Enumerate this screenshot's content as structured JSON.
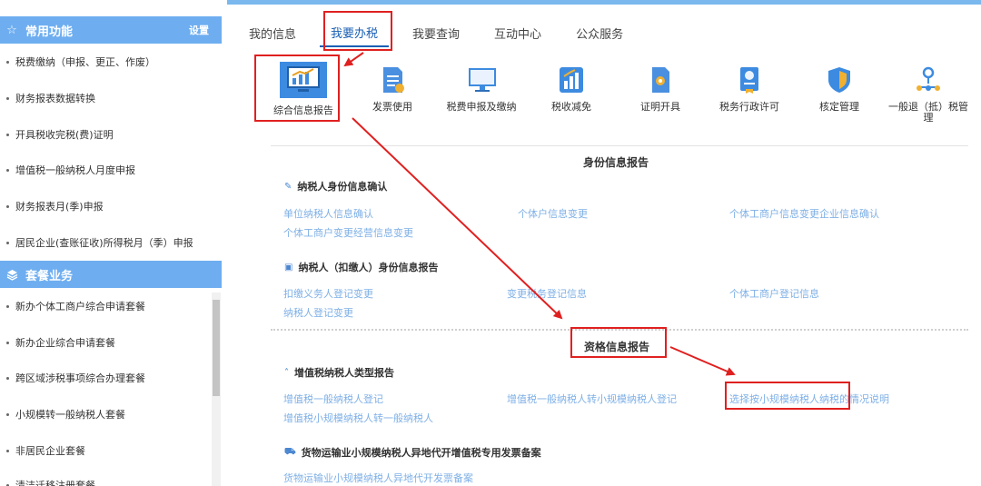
{
  "sidebar": {
    "common": {
      "title": "常用功能",
      "settings_label": "设置",
      "items": [
        "税费缴纳（申报、更正、作废）",
        "财务报表数据转换",
        "开具税收完税(费)证明",
        "增值税一般纳税人月度申报",
        "财务报表月(季)申报",
        "居民企业(查账征收)所得税月（季）申报"
      ]
    },
    "package": {
      "title": "套餐业务",
      "items": [
        "新办个体工商户综合申请套餐",
        "新办企业综合申请套餐",
        "跨区域涉税事项综合办理套餐",
        "小规模转一般纳税人套餐",
        "非居民企业套餐",
        "清洁迁移注册套餐"
      ]
    }
  },
  "tabs": [
    "我的信息",
    "我要办税",
    "我要查询",
    "互动中心",
    "公众服务"
  ],
  "menu": [
    {
      "label": "综合信息报告",
      "icon": "monitor-chart-icon"
    },
    {
      "label": "发票使用",
      "icon": "invoice-doc-icon"
    },
    {
      "label": "税费申报及缴纳",
      "icon": "computer-screen-icon"
    },
    {
      "label": "税收减免",
      "icon": "bar-chart-icon"
    },
    {
      "label": "证明开具",
      "icon": "certificate-doc-icon"
    },
    {
      "label": "税务行政许可",
      "icon": "license-badge-icon"
    },
    {
      "label": "核定管理",
      "icon": "shield-icon"
    },
    {
      "label": "一般退（抵）税管理",
      "icon": "network-node-icon"
    }
  ],
  "content": {
    "identity": {
      "title": "身份信息报告",
      "groups": [
        {
          "title": "纳税人身份信息确认",
          "links": [
            "单位纳税人信息确认",
            "个体户信息变更",
            "个体工商户信息变更企业信息确认",
            "个体工商户变更经营信息变更"
          ]
        },
        {
          "title": "纳税人（扣缴人）身份信息报告",
          "links": [
            "扣缴义务人登记变更",
            "变更税务登记信息",
            "个体工商户登记信息",
            "纳税人登记变更"
          ]
        }
      ]
    },
    "qualification": {
      "title": "资格信息报告",
      "groups": [
        {
          "title": "增值税纳税人类型报告",
          "links": [
            "增值税一般纳税人登记",
            "增值税一般纳税人转小规模纳税人登记",
            "选择按小规模纳税人纳税的情况说明",
            "增值税小规模纳税人转一般纳税人"
          ]
        },
        {
          "title": "货物运输业小规模纳税人异地代开增值税专用发票备案",
          "links": [
            "货物运输业小规模纳税人异地代开发票备案"
          ]
        }
      ]
    }
  }
}
